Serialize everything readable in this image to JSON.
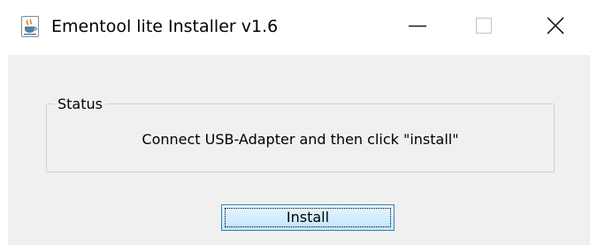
{
  "window": {
    "title": "Ementool lite Installer v1.6",
    "icon": "java-cup-icon",
    "controls": [
      "minimize-icon",
      "maximize-icon",
      "close-icon"
    ]
  },
  "status": {
    "label": "Status",
    "message": "Connect USB-Adapter and then click \"install\""
  },
  "actions": {
    "install_label": "Install"
  },
  "colors": {
    "content_background": "#f0f0f0",
    "button_border": "#3c7fb1",
    "button_fill": "#bee6fd"
  }
}
